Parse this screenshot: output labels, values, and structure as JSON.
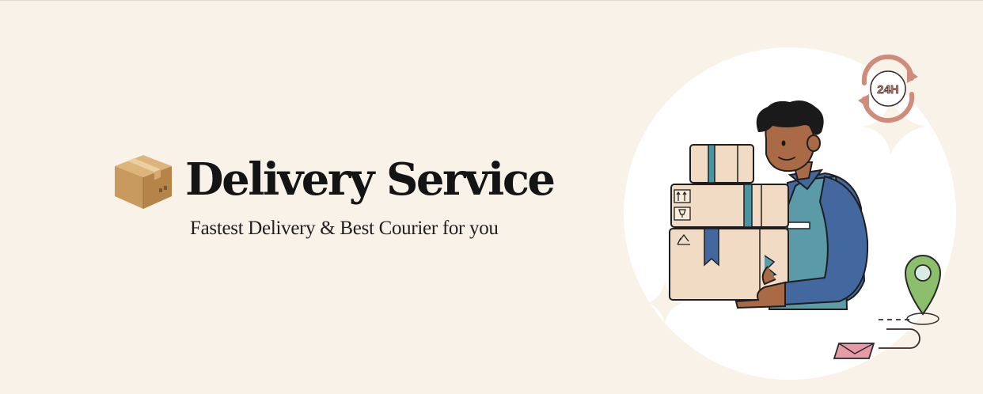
{
  "hero": {
    "title": "Delivery Service",
    "subtitle": "Fastest Delivery & Best Courier for you"
  },
  "badge": {
    "label": "24H"
  },
  "icons": {
    "title_icon": "cardboard-box-icon",
    "badge_icon": "24h-refresh-icon",
    "pin_icon": "location-pin-icon",
    "envelope_icon": "envelope-icon"
  },
  "colors": {
    "background": "#f9f2e9",
    "circle": "#ffffff",
    "box": "#f2dbc4",
    "tape": "#4a95a3",
    "shirt": "#43679f",
    "apron": "#5b9ba8",
    "skin": "#a96a45",
    "pin": "#8bbf6b",
    "envelope": "#e89aa6",
    "badge": "#cf8c7a"
  }
}
